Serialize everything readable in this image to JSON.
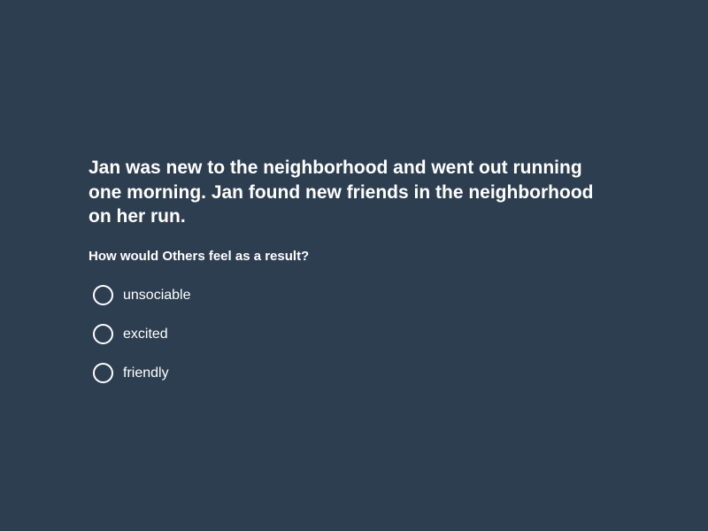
{
  "quiz": {
    "context": "Jan was new to the neighborhood and went out running one morning. Jan found new friends in the neighborhood on her run.",
    "question": "How would Others feel as a result?",
    "options": [
      {
        "label": "unsociable",
        "selected": false
      },
      {
        "label": "excited",
        "selected": false
      },
      {
        "label": "friendly",
        "selected": false
      }
    ]
  },
  "colors": {
    "background": "#2d3e50",
    "text": "#ffffff",
    "radio_border": "#ffffff"
  }
}
